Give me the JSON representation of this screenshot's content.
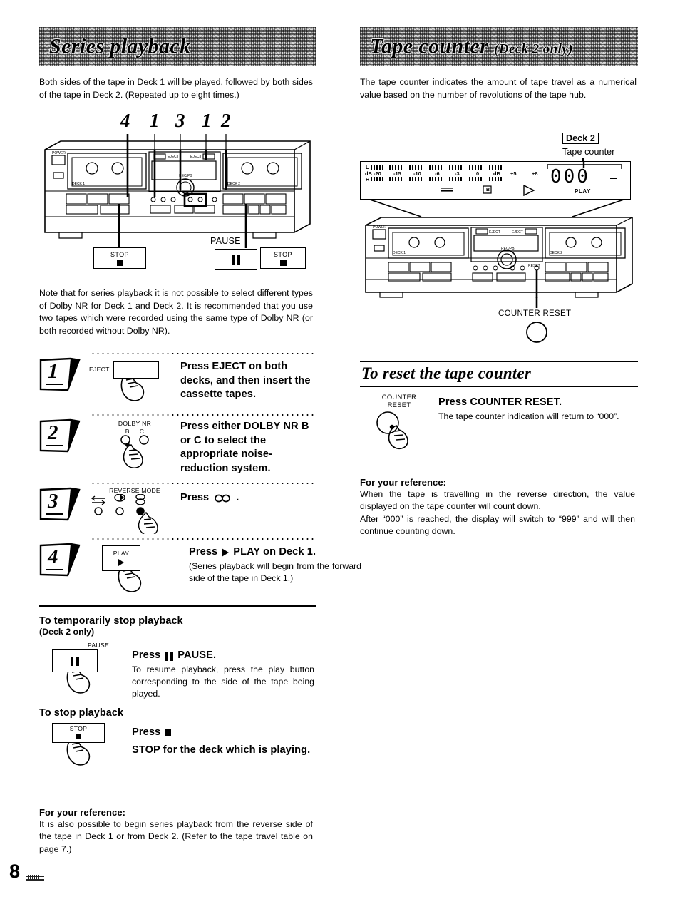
{
  "page": {
    "number": "8"
  },
  "left": {
    "heading": "Series playback",
    "intro": "Both sides of the tape in Deck 1 will be played, followed by both sides of the tape in Deck 2. (Repeated up to eight times.)",
    "callout_numbers": [
      "4",
      "1",
      "3",
      "1",
      "2"
    ],
    "diagram": {
      "deck1_label": "DECK 1",
      "deck2_label": "DECK 2",
      "power_label": "POWER",
      "eject1_label": "EJECT",
      "eject2_label": "EJECT",
      "callouts": [
        {
          "label": "STOP",
          "icon": "stop-square"
        },
        {
          "label": "PAUSE",
          "icon": "pause-bars"
        },
        {
          "label": "STOP",
          "icon": "stop-square"
        }
      ]
    },
    "note": "Note that for series playback it is not possible to select different types of Dolby NR for Deck 1 and Deck 2. It is recommended that you use two tapes which were recorded using the same type of Dolby NR (or both recorded without Dolby NR).",
    "steps": [
      {
        "num": "1",
        "control_label": "EJECT",
        "control_type": "blank-key",
        "lead": "Press EJECT on both decks, and then insert the cassette tapes.",
        "detail": ""
      },
      {
        "num": "2",
        "control_label": "DOLBY NR",
        "control_type": "two-buttons",
        "button_labels": [
          "B",
          "C"
        ],
        "lead": "Press either DOLBY NR B or C to select the appropriate noise-reduction system.",
        "detail": ""
      },
      {
        "num": "3",
        "control_label": "REVERSE MODE",
        "control_type": "three-buttons",
        "lead": "Press ∞.",
        "lead_prefix": "Press",
        "lead_icon": "infinity-loop",
        "detail": ""
      },
      {
        "num": "4",
        "control_label": "PLAY",
        "control_type": "play-key",
        "lead_prefix": "Press",
        "lead_icon": "play-triangle",
        "lead_suffix": "PLAY on Deck 1.",
        "detail": "(Series playback will begin from the forward side of the tape in Deck 1.)"
      }
    ],
    "sections": [
      {
        "title": "To temporarily stop playback",
        "subtitle": "(Deck 2 only)",
        "control_label": "PAUSE",
        "control_icon": "pause-bars",
        "lead_prefix": "Press",
        "lead_icon": "pause-bars",
        "lead_suffix": "PAUSE.",
        "detail": "To resume playback, press the play button corresponding to the side of the tape being played."
      },
      {
        "title": "To stop playback",
        "subtitle": "",
        "control_label": "STOP",
        "control_icon": "stop-square",
        "lead_prefix": "Press",
        "lead_icon": "stop-square",
        "lead_suffix": "STOP for the deck which is playing.",
        "detail": ""
      }
    ],
    "reference": {
      "title": "For your reference:",
      "body": "It is also possible to begin series playback from the reverse side of the tape in Deck 1 or from Deck 2. (Refer to the tape travel table on page 7.)"
    }
  },
  "right": {
    "heading": "Tape counter",
    "heading_suffix": "(Deck 2 only)",
    "intro": "The tape counter indicates the amount of tape travel as a numerical value based on the number of revolutions of the tape hub.",
    "tag": {
      "label": "Deck 2",
      "sub": "Tape counter"
    },
    "display": {
      "meter_left_label": "L",
      "meter_right_label": "R",
      "db_label": "dB",
      "db_scale": [
        "-20",
        "-15",
        "-10",
        "-6",
        "-3",
        "0",
        "dB",
        "+5",
        "+8"
      ],
      "counter_value": "000",
      "play_label": "PLAY",
      "dolby_label": "B",
      "reverse_icon": "reverse-arrows",
      "play_icon": "play-triangle"
    },
    "diagram": {
      "deck1_label": "DECK 1",
      "deck2_label": "DECK 2",
      "counter_reset_callout": "COUNTER RESET"
    },
    "reset_section": {
      "title": "To reset the tape counter",
      "control_label_line1": "COUNTER",
      "control_label_line2": "RESET",
      "lead": "Press COUNTER RESET.",
      "detail": "The tape counter indication will return to “000”."
    },
    "reference": {
      "title": "For your reference:",
      "body_line1": "When the tape is travelling in the reverse direction, the value displayed on the tape counter will count down.",
      "body_line2": "After “000” is reached, the display will switch to “999” and will then continue counting down."
    }
  }
}
